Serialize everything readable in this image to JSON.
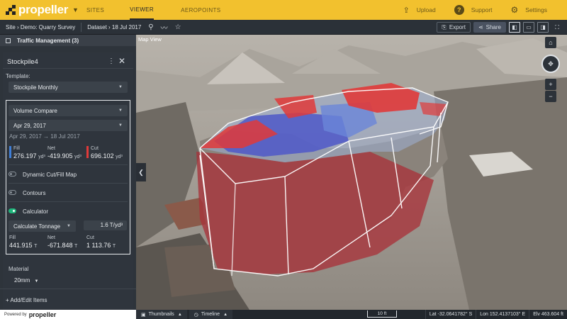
{
  "app": {
    "logo_text": "propeller",
    "nav_tabs": [
      {
        "label": "SITES",
        "active": false
      },
      {
        "label": "VIEWER",
        "active": true
      },
      {
        "label": "AEROPOINTS",
        "active": false
      }
    ],
    "actions": {
      "upload": "Upload",
      "support": "Support",
      "settings": "Settings"
    },
    "brand_color": "#f2c12e"
  },
  "subbar": {
    "site": "Site › Demo: Quarry Survey",
    "dataset": "Dataset › 18 Jul 2017",
    "export_label": "Export",
    "share_label": "Share"
  },
  "panel": {
    "traffic_management": "Traffic Management (3)",
    "title": "Stockpile4",
    "template_label": "Template:",
    "template_value": "Stockpile Monthly",
    "compare_mode": "Volume Compare",
    "compare_date": "Apr 29, 2017",
    "date_from": "Apr 29, 2017",
    "date_to": "18 Jul 2017",
    "volumes": {
      "fill_label": "Fill",
      "fill_value": "276.197",
      "fill_unit": "yd³",
      "net_label": "Net",
      "net_value": "-419.905",
      "net_unit": "yd³",
      "cut_label": "Cut",
      "cut_value": "696.102",
      "cut_unit": "yd³"
    },
    "toggles": [
      {
        "label": "Dynamic Cut/Fill Map",
        "on": false
      },
      {
        "label": "Contours",
        "on": false
      },
      {
        "label": "Calculator",
        "on": true
      }
    ],
    "calc_mode": "Calculate Tonnage",
    "density": "1.6 T/yd³",
    "tonnage": {
      "fill_label": "Fill",
      "fill_value": "441.915",
      "fill_unit": "T",
      "net_label": "Net",
      "net_value": "-671.848",
      "net_unit": "T",
      "cut_label": "Cut",
      "cut_value": "1 113.76",
      "cut_unit": "T"
    },
    "material_label": "Material",
    "material_value": "20mm",
    "add_edit": "+ Add/Edit Items",
    "powered_by": "Powered by",
    "powered_brand": "propeller",
    "fill_color": "#3f7fd8",
    "cut_color": "#e03a3a"
  },
  "map": {
    "label": "Map View",
    "bottom_tabs": {
      "thumbnails": "Thumbnails",
      "timeline": "Timeline"
    },
    "scale": "10 ft",
    "lat": "Lat -32.0641782° S",
    "lon": "Lon 152.4137103° E",
    "elv": "Elv 463.604 ft"
  }
}
